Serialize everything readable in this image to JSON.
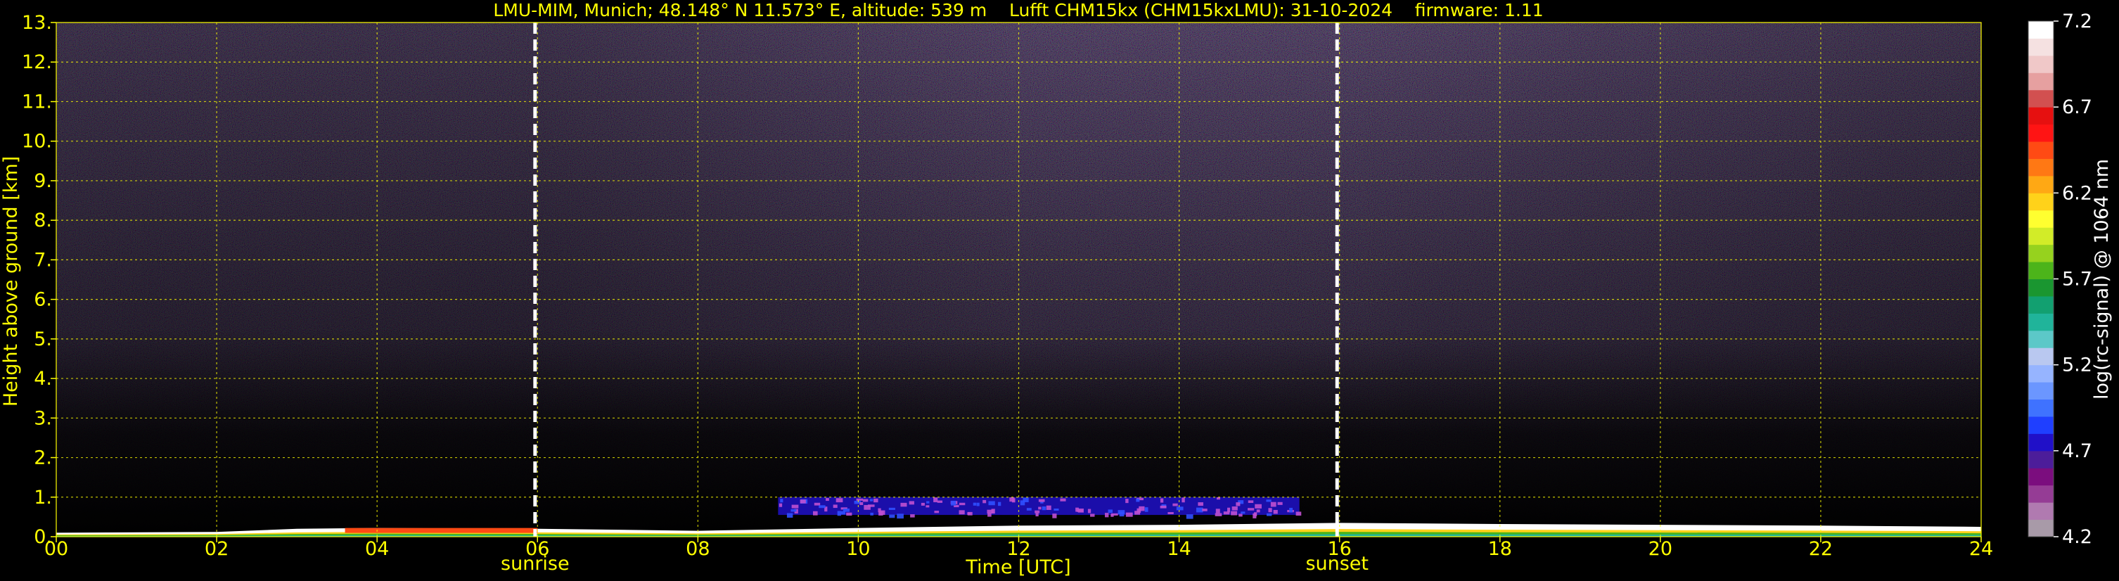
{
  "chart_data": {
    "type": "heatmap",
    "title": "LMU-MIM, Munich; 48.148° N 11.573° E, altitude: 539 m    Lufft CHM15kx (CHM15kxLMU): 31-10-2024    firmware: 1.11",
    "xlabel": "Time [UTC]",
    "ylabel": "Height above ground [km]",
    "xlim": [
      0,
      24
    ],
    "ylim": [
      0,
      13
    ],
    "x_ticks": [
      0,
      2,
      4,
      6,
      8,
      10,
      12,
      14,
      16,
      18,
      20,
      22,
      24
    ],
    "x_tick_labels": [
      "00",
      "02",
      "04",
      "06",
      "08",
      "10",
      "12",
      "14",
      "16",
      "18",
      "20",
      "22",
      "24"
    ],
    "y_ticks": [
      0,
      1,
      2,
      3,
      4,
      5,
      6,
      7,
      8,
      9,
      10,
      11,
      12,
      13
    ],
    "y_tick_labels": [
      "0.",
      "1.",
      "2.",
      "3.",
      "4.",
      "5.",
      "6.",
      "7.",
      "8.",
      "9.",
      "10.",
      "11.",
      "12.",
      "13."
    ],
    "grid": true,
    "markers": [
      {
        "x": 5.97,
        "label": "sunrise"
      },
      {
        "x": 15.97,
        "label": "sunset"
      }
    ],
    "colorbar": {
      "label": "log(rc-signal) @ 1064 nm",
      "range": [
        4.2,
        7.2
      ],
      "tick_values": [
        4.2,
        4.7,
        5.2,
        5.7,
        6.2,
        6.7,
        7.2
      ],
      "tick_labels": [
        "4.2",
        "4.7",
        "5.2",
        "5.7",
        "6.2",
        "6.7",
        "7.2"
      ],
      "colors": [
        "#a89aa8",
        "#b07ab0",
        "#953c95",
        "#7b0d7e",
        "#4c1d9a",
        "#2010c8",
        "#1f3fff",
        "#3f72ff",
        "#6b96ff",
        "#96b4ff",
        "#b9c8f0",
        "#5cc8c8",
        "#20b49a",
        "#12a070",
        "#1a9630",
        "#4cb41a",
        "#96d21e",
        "#d2ec28",
        "#ffff30",
        "#ffd21a",
        "#ffa814",
        "#ff7814",
        "#ff4a14",
        "#ff1414",
        "#e61010",
        "#d25050",
        "#e6a0a0",
        "#f0c8c8",
        "#f5e1e1",
        "#ffffff"
      ]
    },
    "layers": [
      {
        "name": "noise-background",
        "x_range": [
          0,
          24
        ],
        "y_range": [
          0,
          13
        ]
      },
      {
        "name": "aerosol-layer",
        "x_range": [
          9.0,
          15.5
        ],
        "y_range": [
          0.55,
          1.0
        ],
        "level": 4.8
      },
      {
        "name": "near-surface-signal",
        "x_range": [
          0,
          24
        ],
        "y_range": [
          0,
          0.25
        ],
        "level": 7.0
      }
    ]
  }
}
